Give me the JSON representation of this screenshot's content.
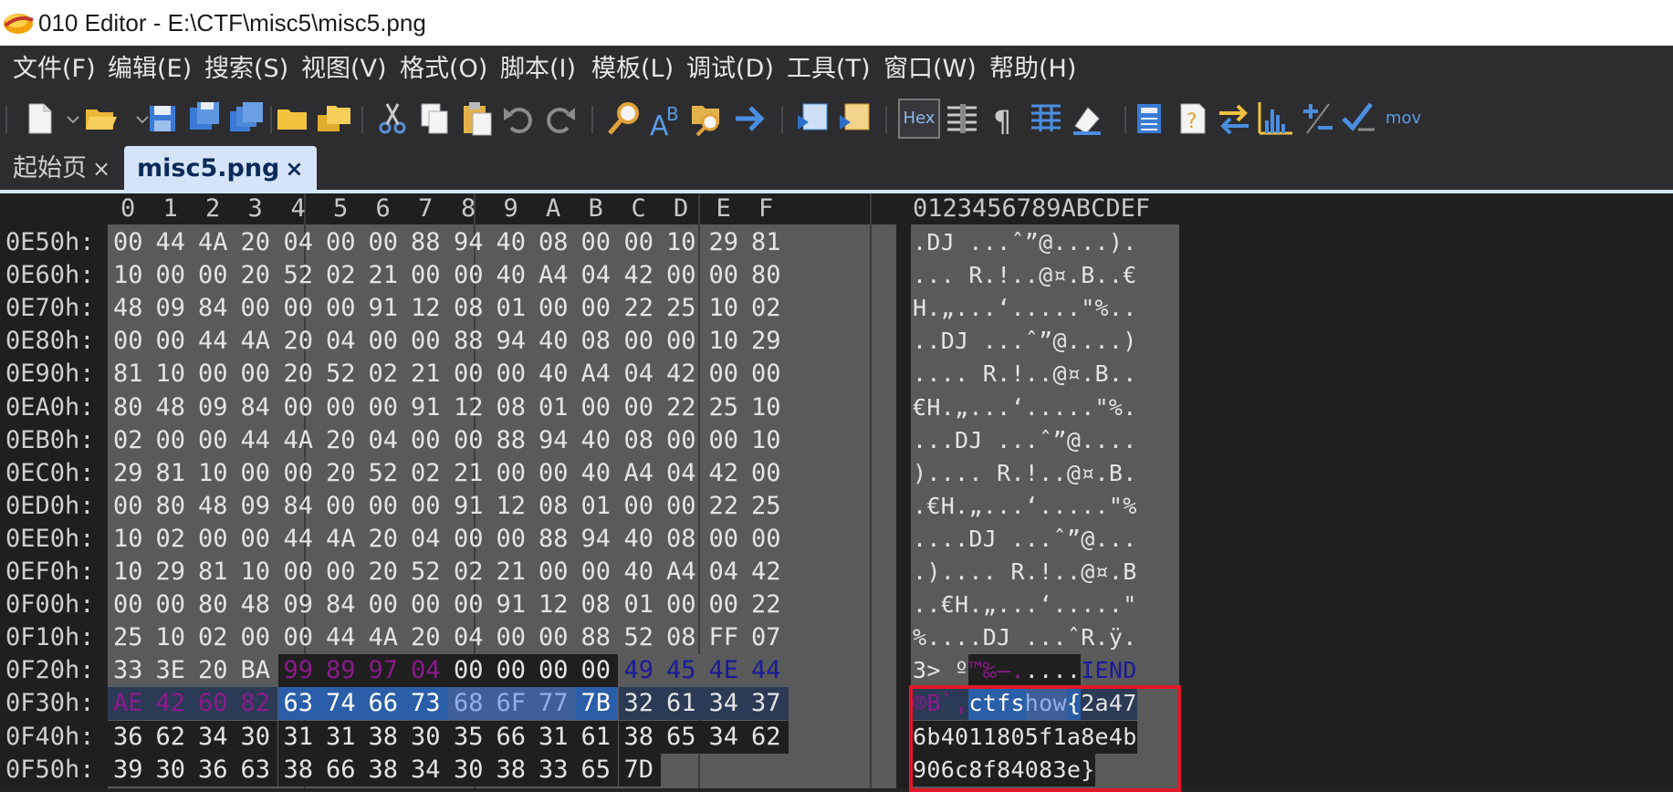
{
  "window": {
    "title": "010 Editor - E:\\CTF\\misc5\\misc5.png"
  },
  "menubar": {
    "items": [
      "文件(F)",
      "编辑(E)",
      "搜索(S)",
      "视图(V)",
      "格式(O)",
      "脚本(I)",
      "模板(L)",
      "调试(D)",
      "工具(T)",
      "窗口(W)",
      "帮助(H)"
    ]
  },
  "toolbar": {
    "hex_label": "Hex",
    "mov_label": "mov",
    "icons": [
      "new-file-icon",
      "open-folder-icon",
      "save-icon",
      "save-as-icon",
      "save-all-icon",
      "folder-icon",
      "multi-folder-icon",
      "cut-icon",
      "copy-icon",
      "paste-icon",
      "undo-icon",
      "redo-icon",
      "find-icon",
      "replace-icon",
      "find-in-files-icon",
      "goto-icon",
      "run-script-icon",
      "run-template-icon",
      "hex-toggle-icon",
      "columns-icon",
      "pilcrow-icon",
      "table-icon",
      "highlight-icon",
      "calculator-icon",
      "help-icon",
      "compare-icon",
      "histogram-icon",
      "plus-minus-icon",
      "checksum-icon"
    ]
  },
  "tabs": [
    {
      "label": "起始页",
      "close": "×",
      "active": false
    },
    {
      "label": "misc5.png",
      "close": "×",
      "active": true
    }
  ],
  "hex": {
    "column_headers": [
      "0",
      "1",
      "2",
      "3",
      "4",
      "5",
      "6",
      "7",
      "8",
      "9",
      "A",
      "B",
      "C",
      "D",
      "E",
      "F"
    ],
    "ascii_header": "0123456789ABCDEF",
    "rows": [
      {
        "addr": "0E50h:",
        "bytes": [
          "00",
          "44",
          "4A",
          "20",
          "04",
          "00",
          "00",
          "88",
          "94",
          "40",
          "08",
          "00",
          "00",
          "10",
          "29",
          "81"
        ],
        "ascii": ".DJ ...ˆ”@....)."
      },
      {
        "addr": "0E60h:",
        "bytes": [
          "10",
          "00",
          "00",
          "20",
          "52",
          "02",
          "21",
          "00",
          "00",
          "40",
          "A4",
          "04",
          "42",
          "00",
          "00",
          "80"
        ],
        "ascii": "... R.!..@¤.B..€"
      },
      {
        "addr": "0E70h:",
        "bytes": [
          "48",
          "09",
          "84",
          "00",
          "00",
          "00",
          "91",
          "12",
          "08",
          "01",
          "00",
          "00",
          "22",
          "25",
          "10",
          "02"
        ],
        "ascii": "H.„...‘.....\"%.."
      },
      {
        "addr": "0E80h:",
        "bytes": [
          "00",
          "00",
          "44",
          "4A",
          "20",
          "04",
          "00",
          "00",
          "88",
          "94",
          "40",
          "08",
          "00",
          "00",
          "10",
          "29"
        ],
        "ascii": "..DJ ...ˆ”@....)"
      },
      {
        "addr": "0E90h:",
        "bytes": [
          "81",
          "10",
          "00",
          "00",
          "20",
          "52",
          "02",
          "21",
          "00",
          "00",
          "40",
          "A4",
          "04",
          "42",
          "00",
          "00"
        ],
        "ascii": ".... R.!..@¤.B.."
      },
      {
        "addr": "0EA0h:",
        "bytes": [
          "80",
          "48",
          "09",
          "84",
          "00",
          "00",
          "00",
          "91",
          "12",
          "08",
          "01",
          "00",
          "00",
          "22",
          "25",
          "10"
        ],
        "ascii": "€H.„...‘.....\"%."
      },
      {
        "addr": "0EB0h:",
        "bytes": [
          "02",
          "00",
          "00",
          "44",
          "4A",
          "20",
          "04",
          "00",
          "00",
          "88",
          "94",
          "40",
          "08",
          "00",
          "00",
          "10"
        ],
        "ascii": "...DJ ...ˆ”@...."
      },
      {
        "addr": "0EC0h:",
        "bytes": [
          "29",
          "81",
          "10",
          "00",
          "00",
          "20",
          "52",
          "02",
          "21",
          "00",
          "00",
          "40",
          "A4",
          "04",
          "42",
          "00"
        ],
        "ascii": ").... R.!..@¤.B."
      },
      {
        "addr": "0ED0h:",
        "bytes": [
          "00",
          "80",
          "48",
          "09",
          "84",
          "00",
          "00",
          "00",
          "91",
          "12",
          "08",
          "01",
          "00",
          "00",
          "22",
          "25"
        ],
        "ascii": ".€H.„...‘.....\"%"
      },
      {
        "addr": "0EE0h:",
        "bytes": [
          "10",
          "02",
          "00",
          "00",
          "44",
          "4A",
          "20",
          "04",
          "00",
          "00",
          "88",
          "94",
          "40",
          "08",
          "00",
          "00"
        ],
        "ascii": "....DJ ...ˆ”@..."
      },
      {
        "addr": "0EF0h:",
        "bytes": [
          "10",
          "29",
          "81",
          "10",
          "00",
          "00",
          "20",
          "52",
          "02",
          "21",
          "00",
          "00",
          "40",
          "A4",
          "04",
          "42"
        ],
        "ascii": ".).... R.!..@¤.B"
      },
      {
        "addr": "0F00h:",
        "bytes": [
          "00",
          "00",
          "80",
          "48",
          "09",
          "84",
          "00",
          "00",
          "00",
          "91",
          "12",
          "08",
          "01",
          "00",
          "00",
          "22"
        ],
        "ascii": "..€H.„...‘.....\""
      },
      {
        "addr": "0F10h:",
        "bytes": [
          "25",
          "10",
          "02",
          "00",
          "00",
          "44",
          "4A",
          "20",
          "04",
          "00",
          "00",
          "88",
          "52",
          "08",
          "FF",
          "07"
        ],
        "ascii": "%....DJ ...ˆR.ÿ."
      },
      {
        "addr": "0F20h:",
        "bytes": [
          "33",
          "3E",
          "20",
          "BA",
          "99",
          "89",
          "97",
          "04",
          "00",
          "00",
          "00",
          "00",
          "49",
          "45",
          "4E",
          "44"
        ],
        "ascii": "3> º™‰—.....IEND"
      },
      {
        "addr": "0F30h:",
        "bytes": [
          "AE",
          "42",
          "60",
          "82",
          "63",
          "74",
          "66",
          "73",
          "68",
          "6F",
          "77",
          "7B",
          "32",
          "61",
          "34",
          "37"
        ],
        "ascii": "®B`‚ctfshow{2a47"
      },
      {
        "addr": "0F40h:",
        "bytes": [
          "36",
          "62",
          "34",
          "30",
          "31",
          "31",
          "38",
          "30",
          "35",
          "66",
          "31",
          "61",
          "38",
          "65",
          "34",
          "62"
        ],
        "ascii": "6b4011805f1a8e4b"
      },
      {
        "addr": "0F50h:",
        "bytes": [
          "39",
          "30",
          "36",
          "63",
          "38",
          "66",
          "38",
          "34",
          "30",
          "38",
          "33",
          "65",
          "7D"
        ],
        "ascii": "906c8f84083e}"
      }
    ]
  },
  "colors": {
    "grey_byte_bg": "#5a5a5a",
    "chunk_type_fg": "#8a1a8a",
    "chunk_type_bg": "#1f1f1f",
    "crc_fg": "#1a1a9a",
    "crc_bg": "#5a5a5a",
    "selection_bg": "#2a5ea8",
    "selection_light_bg": "#3f5f9a",
    "selection_fg": "#ffffff",
    "tail_bg": "#2b3a55",
    "highlight_box": "#e0192a"
  }
}
